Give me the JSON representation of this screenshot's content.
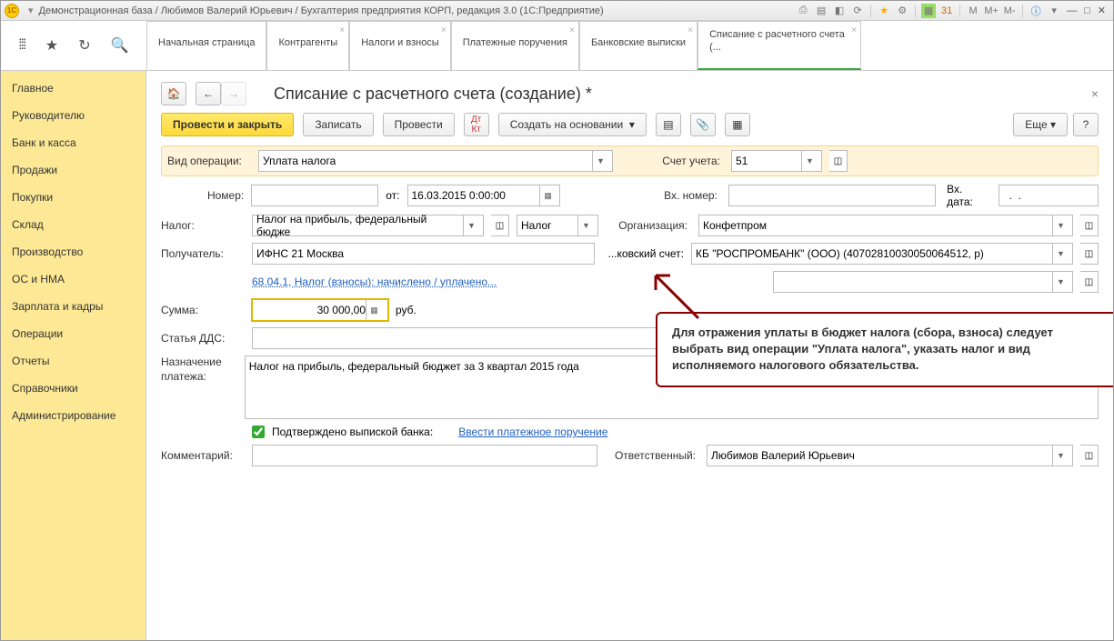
{
  "titlebar": {
    "logo": "1C",
    "text": "Демонстрационная база / Любимов Валерий Юрьевич / Бухгалтерия предприятия КОРП, редакция 3.0  (1С:Предприятие)"
  },
  "tabs": [
    {
      "label": "Начальная страница",
      "closable": false
    },
    {
      "label": "Контрагенты",
      "closable": true
    },
    {
      "label": "Налоги и взносы",
      "closable": true
    },
    {
      "label": "Платежные поручения",
      "closable": true
    },
    {
      "label": "Банковские выписки",
      "closable": true
    },
    {
      "label": "Списание с расчетного счета (...",
      "closable": true,
      "active": true
    }
  ],
  "sidebar": [
    "Главное",
    "Руководителю",
    "Банк и касса",
    "Продажи",
    "Покупки",
    "Склад",
    "Производство",
    "ОС и НМА",
    "Зарплата и кадры",
    "Операции",
    "Отчеты",
    "Справочники",
    "Администрирование"
  ],
  "page": {
    "title": "Списание с расчетного счета (создание) *",
    "buttons": {
      "post_close": "Провести и закрыть",
      "record": "Записать",
      "post": "Провести",
      "create_based": "Создать на основании",
      "more": "Еще",
      "help": "?"
    },
    "labels": {
      "op_type": "Вид операции:",
      "account": "Счет учета:",
      "number": "Номер:",
      "date_from": "от:",
      "in_num": "Вх. номер:",
      "in_date": "Вх. дата:",
      "tax": "Налог:",
      "tax2": "Налог",
      "org": "Организация:",
      "recipient": "Получатель:",
      "bank_acc": "...ковский счет:",
      "sum": "Сумма:",
      "currency": "руб.",
      "dds": "Статья ДДС:",
      "purpose": "Назначение платежа:",
      "confirm": "Подтверждено выпиской банка:",
      "enter_pay": "Ввести платежное поручение",
      "comment": "Комментарий:",
      "resp": "Ответственный:",
      "tax_link": "68.04.1, Налог (взносы): начислено / уплачено..."
    },
    "values": {
      "op_type": "Уплата налога",
      "account": "51",
      "number": "",
      "date": "16.03.2015  0:00:00",
      "in_num": "",
      "in_date": "  .  .    ",
      "tax": "Налог на прибыль, федеральный бюдже",
      "org": "Конфетпром",
      "recipient": "ИФНС 21 Москва",
      "bank_acc": "КБ \"РОСПРОМБАНК\" (ООО) (40702810030050064512, р)",
      "sum": "30 000,00",
      "purpose": "Налог на прибыль, федеральный бюджет за 3 квартал 2015 года",
      "resp": "Любимов Валерий Юрьевич",
      "comment": ""
    }
  },
  "callout": "Для отражения уплаты в бюджет налога (сбора, взноса) следует выбрать вид операции \"Уплата налога\", указать налог и вид исполняемого налогового обязательства."
}
